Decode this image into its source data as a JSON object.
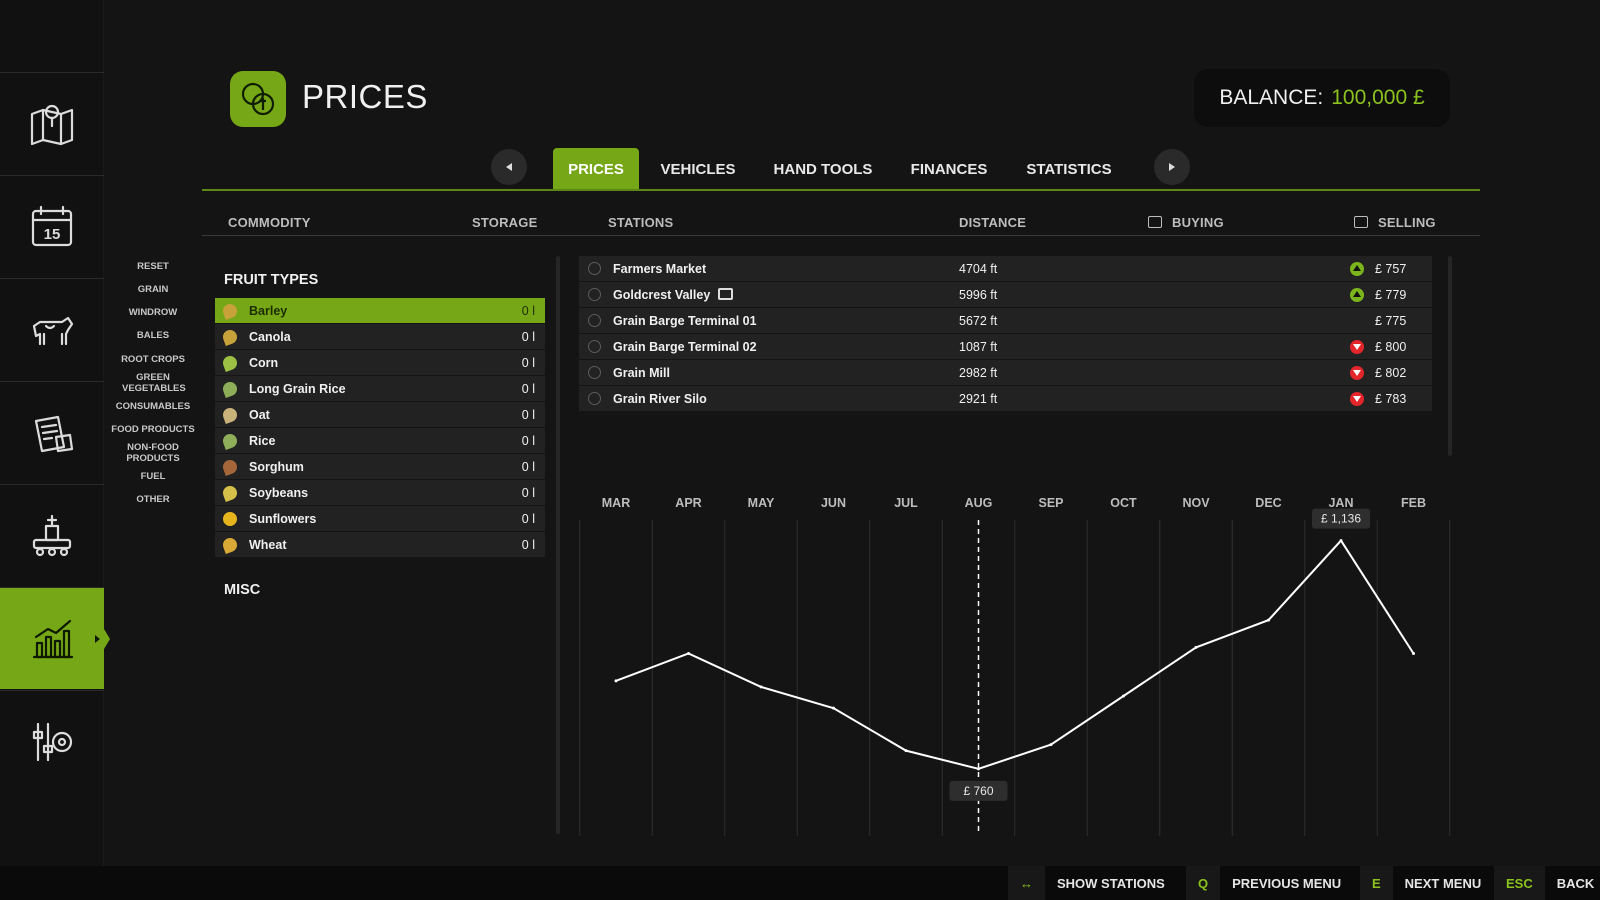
{
  "header": {
    "title": "PRICES",
    "balance_label": "BALANCE:",
    "balance_value": "100,000 £"
  },
  "sidebar": {
    "items": [
      {
        "name": "map-icon"
      },
      {
        "name": "calendar-icon",
        "label": "15"
      },
      {
        "name": "animals-icon"
      },
      {
        "name": "contracts-icon"
      },
      {
        "name": "production-icon"
      },
      {
        "name": "prices-chart-icon",
        "active": true
      },
      {
        "name": "settings-icon"
      }
    ]
  },
  "tabs": [
    {
      "label": "PRICES",
      "active": true
    },
    {
      "label": "VEHICLES"
    },
    {
      "label": "HAND TOOLS"
    },
    {
      "label": "FINANCES"
    },
    {
      "label": "STATISTICS"
    }
  ],
  "columns": {
    "commodity": "COMMODITY",
    "storage": "STORAGE",
    "stations": "STATIONS",
    "distance": "DISTANCE",
    "buying": "BUYING",
    "selling": "SELLING"
  },
  "filters": [
    "RESET",
    "GRAIN",
    "WINDROW",
    "BALES",
    "ROOT CROPS",
    "GREEN VEGETABLES",
    "CONSUMABLES",
    "FOOD PRODUCTS",
    "NON-FOOD PRODUCTS",
    "FUEL",
    "OTHER"
  ],
  "commodities": {
    "fruit_types_title": "FRUIT TYPES",
    "misc_title": "MISC",
    "items": [
      {
        "name": "Barley",
        "storage": "0 l",
        "selected": true
      },
      {
        "name": "Canola",
        "storage": "0 l"
      },
      {
        "name": "Corn",
        "storage": "0 l"
      },
      {
        "name": "Long Grain Rice",
        "storage": "0 l"
      },
      {
        "name": "Oat",
        "storage": "0 l"
      },
      {
        "name": "Rice",
        "storage": "0 l"
      },
      {
        "name": "Sorghum",
        "storage": "0 l"
      },
      {
        "name": "Soybeans",
        "storage": "0 l"
      },
      {
        "name": "Sunflowers",
        "storage": "0 l"
      },
      {
        "name": "Wheat",
        "storage": "0 l"
      }
    ]
  },
  "stations": [
    {
      "name": "Farmers Market",
      "distance": "4704 ft",
      "trend": "up",
      "price": "£ 757"
    },
    {
      "name": "Goldcrest Valley",
      "distance": "5996 ft",
      "trend": "up",
      "price": "£ 779",
      "train": true
    },
    {
      "name": "Grain Barge Terminal 01",
      "distance": "5672 ft",
      "trend": "none",
      "price": "£ 775"
    },
    {
      "name": "Grain Barge Terminal 02",
      "distance": "1087 ft",
      "trend": "down",
      "price": "£ 800"
    },
    {
      "name": "Grain Mill",
      "distance": "2982 ft",
      "trend": "down",
      "price": "£ 802"
    },
    {
      "name": "Grain River Silo",
      "distance": "2921 ft",
      "trend": "down",
      "price": "£ 783"
    }
  ],
  "chart_data": {
    "type": "line",
    "categories": [
      "MAR",
      "APR",
      "MAY",
      "JUN",
      "JUL",
      "AUG",
      "SEP",
      "OCT",
      "NOV",
      "DEC",
      "JAN",
      "FEB"
    ],
    "values": [
      905,
      950,
      895,
      860,
      790,
      760,
      800,
      880,
      960,
      1005,
      1136,
      950
    ],
    "current_marker": "AUG",
    "annotations": [
      {
        "category": "AUG",
        "label": "£ 760"
      },
      {
        "category": "JAN",
        "label": "£ 1,136"
      }
    ],
    "ylim": [
      740,
      1160
    ]
  },
  "footer": {
    "hints": [
      {
        "key": "↔",
        "label": "SHOW STATIONS"
      },
      {
        "key": "Q",
        "label": "PREVIOUS MENU"
      },
      {
        "key": "E",
        "label": "NEXT MENU"
      },
      {
        "key": "ESC",
        "label": "BACK"
      }
    ]
  },
  "colors": {
    "accent": "#76a716",
    "accent_text": "#8cc21e",
    "up": "#7cb51b",
    "down": "#e4262b",
    "background": "#141414"
  }
}
